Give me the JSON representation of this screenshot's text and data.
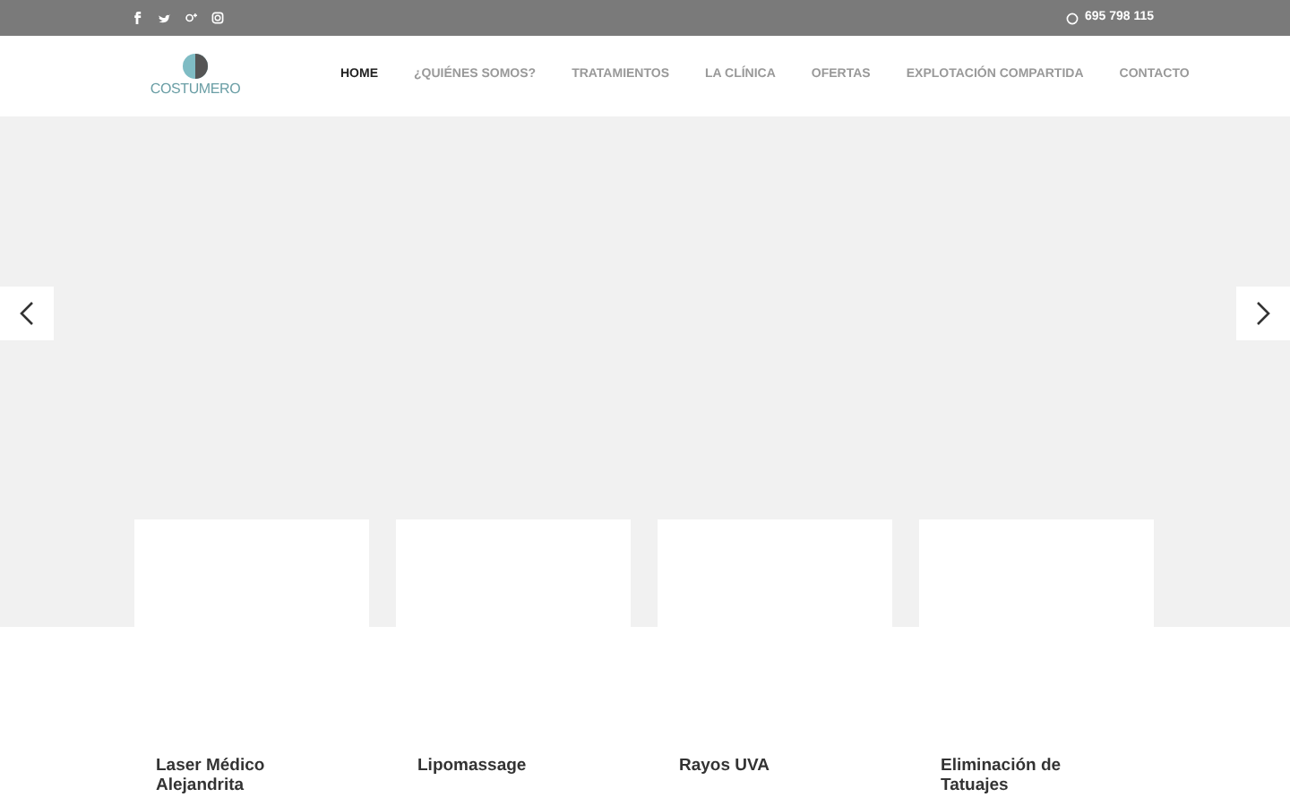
{
  "topbar": {
    "social": [
      {
        "kind": "facebook"
      },
      {
        "kind": "twitter"
      },
      {
        "kind": "google-plus"
      },
      {
        "kind": "instagram"
      }
    ],
    "phone": "695 798 115"
  },
  "logo": {
    "text": "COSTUMERO"
  },
  "nav": [
    {
      "label": "HOME",
      "selected": true
    },
    {
      "label": "¿QUIÉNES SOMOS?",
      "selected": false
    },
    {
      "label": "TRATAMIENTOS",
      "selected": false
    },
    {
      "label": "LA CLÍNICA",
      "selected": false
    },
    {
      "label": "OFERTAS",
      "selected": false
    },
    {
      "label": "EXPLOTACIÓN COMPARTIDA",
      "selected": false
    },
    {
      "label": "CONTACTO",
      "selected": false
    }
  ],
  "features": [
    {
      "title": "Laser Médico Alejandrita"
    },
    {
      "title": "Lipomassage"
    },
    {
      "title": "Rayos UVA"
    },
    {
      "title": "Eliminación de Tatuajes"
    }
  ]
}
